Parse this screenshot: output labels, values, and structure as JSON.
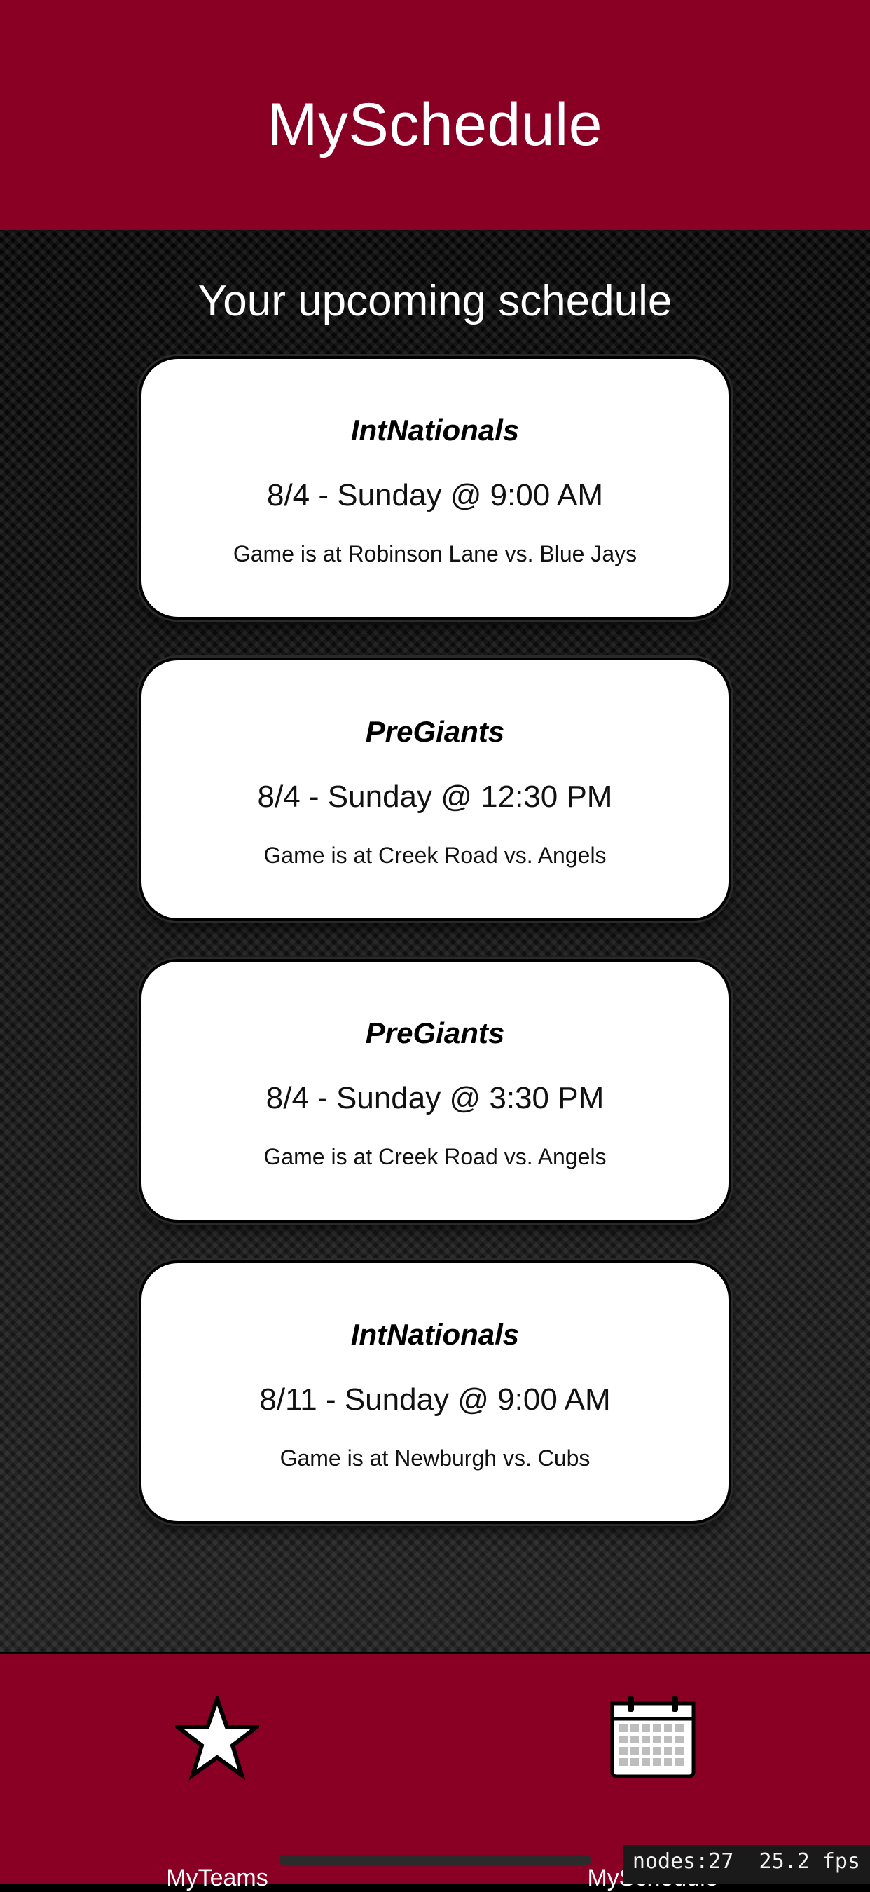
{
  "app": {
    "title": "MySchedule"
  },
  "main": {
    "subtitle": "Your upcoming schedule",
    "games": [
      {
        "team": "IntNationals",
        "when": "8/4 - Sunday @ 9:00 AM",
        "where": "Game is at Robinson Lane vs. Blue Jays"
      },
      {
        "team": "PreGiants",
        "when": "8/4 - Sunday @ 12:30 PM",
        "where": "Game is at Creek Road vs. Angels"
      },
      {
        "team": "PreGiants",
        "when": "8/4 - Sunday @ 3:30 PM",
        "where": "Game is at Creek Road vs. Angels"
      },
      {
        "team": "IntNationals",
        "when": "8/11 - Sunday @ 9:00 AM",
        "where": "Game is at Newburgh vs. Cubs"
      }
    ]
  },
  "tabbar": {
    "tabs": [
      {
        "label": "MyTeams",
        "icon": "star-icon"
      },
      {
        "label": "MySchedule",
        "icon": "calendar-icon"
      }
    ]
  },
  "debug": {
    "text": "nodes:27  25.2 fps"
  },
  "colors": {
    "brand": "#8a0025",
    "card": "#ffffff",
    "background": "#0b0b0b"
  }
}
